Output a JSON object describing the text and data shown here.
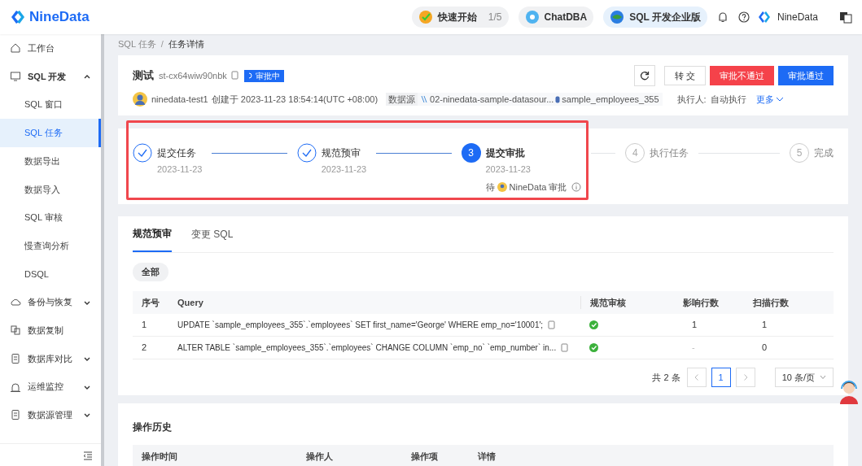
{
  "header": {
    "logo": "NineData",
    "pills": [
      {
        "kind": "quickstart",
        "label": "快速开始",
        "count": "1/5"
      },
      {
        "kind": "chat",
        "label": "ChatDBA"
      },
      {
        "kind": "edition",
        "label": "SQL 开发企业版"
      }
    ],
    "user": "NineData"
  },
  "sidebar": {
    "items": [
      {
        "label": "工作台",
        "selected": false
      },
      {
        "label": "SQL 开发",
        "selected": false,
        "expanded": true,
        "children": [
          {
            "label": "SQL 窗口",
            "selected": false
          },
          {
            "label": "SQL 任务",
            "selected": true
          },
          {
            "label": "数据导出",
            "selected": false
          },
          {
            "label": "数据导入",
            "selected": false
          },
          {
            "label": "SQL 审核",
            "selected": false
          },
          {
            "label": "慢查询分析",
            "selected": false
          },
          {
            "label": "DSQL",
            "selected": false
          }
        ]
      },
      {
        "label": "备份与恢复",
        "selected": false,
        "expanded": false
      },
      {
        "label": "数据复制",
        "selected": false
      },
      {
        "label": "数据库对比",
        "selected": false,
        "expanded": false
      },
      {
        "label": "运维监控",
        "selected": false,
        "expanded": false
      },
      {
        "label": "数据源管理",
        "selected": false,
        "expanded": false
      }
    ]
  },
  "breadcrumb": {
    "items": [
      "SQL 任务",
      "任务详情"
    ],
    "separator": "/"
  },
  "task": {
    "title": "测试",
    "id": "st-cx64wiw90nbk",
    "status": "审批中",
    "creator": "ninedata-test1",
    "created": "创建于 2023-11-23 18:54:14(UTC +08:00)",
    "datasource_label": "数据源",
    "datasource": "02-ninedata-sample-datasour...",
    "database": "sample_employees_355",
    "executor_label": "执行人:",
    "executor": "自动执行",
    "more": "更多",
    "buttons": [
      {
        "kind": "default",
        "label": "转 交"
      },
      {
        "kind": "danger",
        "label": "审批不通过"
      },
      {
        "kind": "primary",
        "label": "审批通过"
      }
    ]
  },
  "steps": [
    {
      "label": "提交任务",
      "date": "2023-11-23",
      "done": true
    },
    {
      "label": "规范预审",
      "date": "2023-11-23",
      "done": true
    },
    {
      "label": "提交审批",
      "date": "2023-11-23",
      "done": false,
      "active": true,
      "number": "3",
      "pending_prefix": "待",
      "pending_user": "NineData 审批"
    },
    {
      "label": "执行任务",
      "done": false,
      "active": false,
      "number": "4"
    },
    {
      "label": "完成",
      "done": false,
      "active": false,
      "number": "5"
    }
  ],
  "tabs": [
    {
      "label": "规范预审",
      "selected": true
    },
    {
      "label": "变更 SQL",
      "selected": false
    }
  ],
  "filter": "全部",
  "table": {
    "columns": [
      "序号",
      "Query",
      "规范审核",
      "影响行数",
      "扫描行数"
    ],
    "rows": [
      {
        "index": "1",
        "query": "UPDATE `sample_employees_355`.`employees` SET first_name='George' WHERE emp_no='10001';",
        "passed": true,
        "affected": "1",
        "scanned": "1"
      },
      {
        "index": "2",
        "query": "ALTER TABLE `sample_employees_355`.`employees` CHANGE COLUMN `emp_no` `emp_number` in...",
        "passed": true,
        "affected": "-",
        "scanned": "0"
      }
    ]
  },
  "pagination": {
    "total": "共 2 条",
    "page": "1",
    "page_size": "10 条/页"
  },
  "history": {
    "title": "操作历史",
    "columns": [
      "操作时间",
      "操作人",
      "操作项",
      "详情"
    ]
  }
}
